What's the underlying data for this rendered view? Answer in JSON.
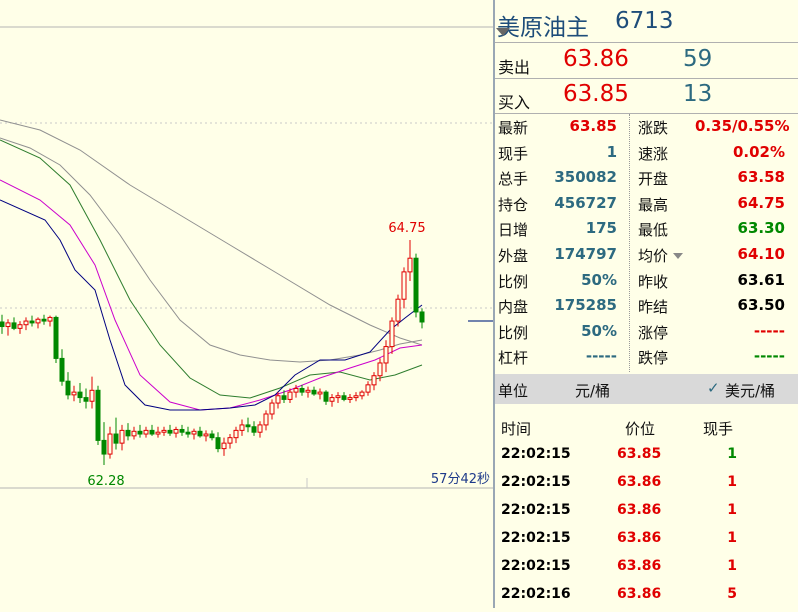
{
  "instrument": {
    "name": "美原油主",
    "code": "6713"
  },
  "quote": {
    "sell_label": "卖出",
    "sell_price": "63.86",
    "sell_volume": "59",
    "buy_label": "买入",
    "buy_price": "63.85",
    "buy_volume": "13"
  },
  "stats_left": [
    {
      "label": "最新",
      "value": "63.85",
      "color": "red"
    },
    {
      "label": "现手",
      "value": "1",
      "color": "blue"
    },
    {
      "label": "总手",
      "value": "350082",
      "color": "blue"
    },
    {
      "label": "持仓",
      "value": "456727",
      "color": "blue"
    },
    {
      "label": "日增",
      "value": "175",
      "color": "blue"
    },
    {
      "label": "外盘",
      "value": "174797",
      "color": "blue"
    },
    {
      "label": "比例",
      "value": "50%",
      "color": "blue"
    },
    {
      "label": "内盘",
      "value": "175285",
      "color": "blue"
    },
    {
      "label": "比例",
      "value": "50%",
      "color": "blue"
    },
    {
      "label": "杠杆",
      "value": "-----",
      "color": "blue"
    }
  ],
  "stats_right": [
    {
      "label": "涨跌",
      "value": "0.35/0.55%",
      "color": "red"
    },
    {
      "label": "速涨",
      "value": "0.02%",
      "color": "red"
    },
    {
      "label": "开盘",
      "value": "63.58",
      "color": "red"
    },
    {
      "label": "最高",
      "value": "64.75",
      "color": "red"
    },
    {
      "label": "最低",
      "value": "63.30",
      "color": "green"
    },
    {
      "label": "均价",
      "value": "64.10",
      "color": "red"
    },
    {
      "label": "昨收",
      "value": "63.61",
      "color": "black"
    },
    {
      "label": "昨结",
      "value": "63.50",
      "color": "black"
    },
    {
      "label": "涨停",
      "value": "-----",
      "color": "red"
    },
    {
      "label": "跌停",
      "value": "-----",
      "color": "green"
    }
  ],
  "unit": {
    "label": "单位",
    "value": "元/桶",
    "option": "美元/桶",
    "check_icon": "check-icon"
  },
  "ticks_header": {
    "time": "时间",
    "price": "价位",
    "qty": "现手"
  },
  "ticks": [
    {
      "time": "22:02:15",
      "price": "63.85",
      "qty": "1",
      "qty_color": "green"
    },
    {
      "time": "22:02:15",
      "price": "63.86",
      "qty": "1",
      "qty_color": "red"
    },
    {
      "time": "22:02:15",
      "price": "63.86",
      "qty": "1",
      "qty_color": "red"
    },
    {
      "time": "22:02:15",
      "price": "63.86",
      "qty": "1",
      "qty_color": "red"
    },
    {
      "time": "22:02:15",
      "price": "63.86",
      "qty": "1",
      "qty_color": "red"
    },
    {
      "time": "22:02:16",
      "price": "63.86",
      "qty": "5",
      "qty_color": "red"
    }
  ],
  "chart": {
    "high_label": "64.75",
    "low_label": "62.28",
    "countdown": "57分42秒",
    "colors": {
      "up": "#e00000",
      "down": "#008800",
      "ma5": "#000080",
      "ma10": "#cc00cc",
      "ma20": "#2e7d2e",
      "ma60": "#909090"
    }
  }
}
